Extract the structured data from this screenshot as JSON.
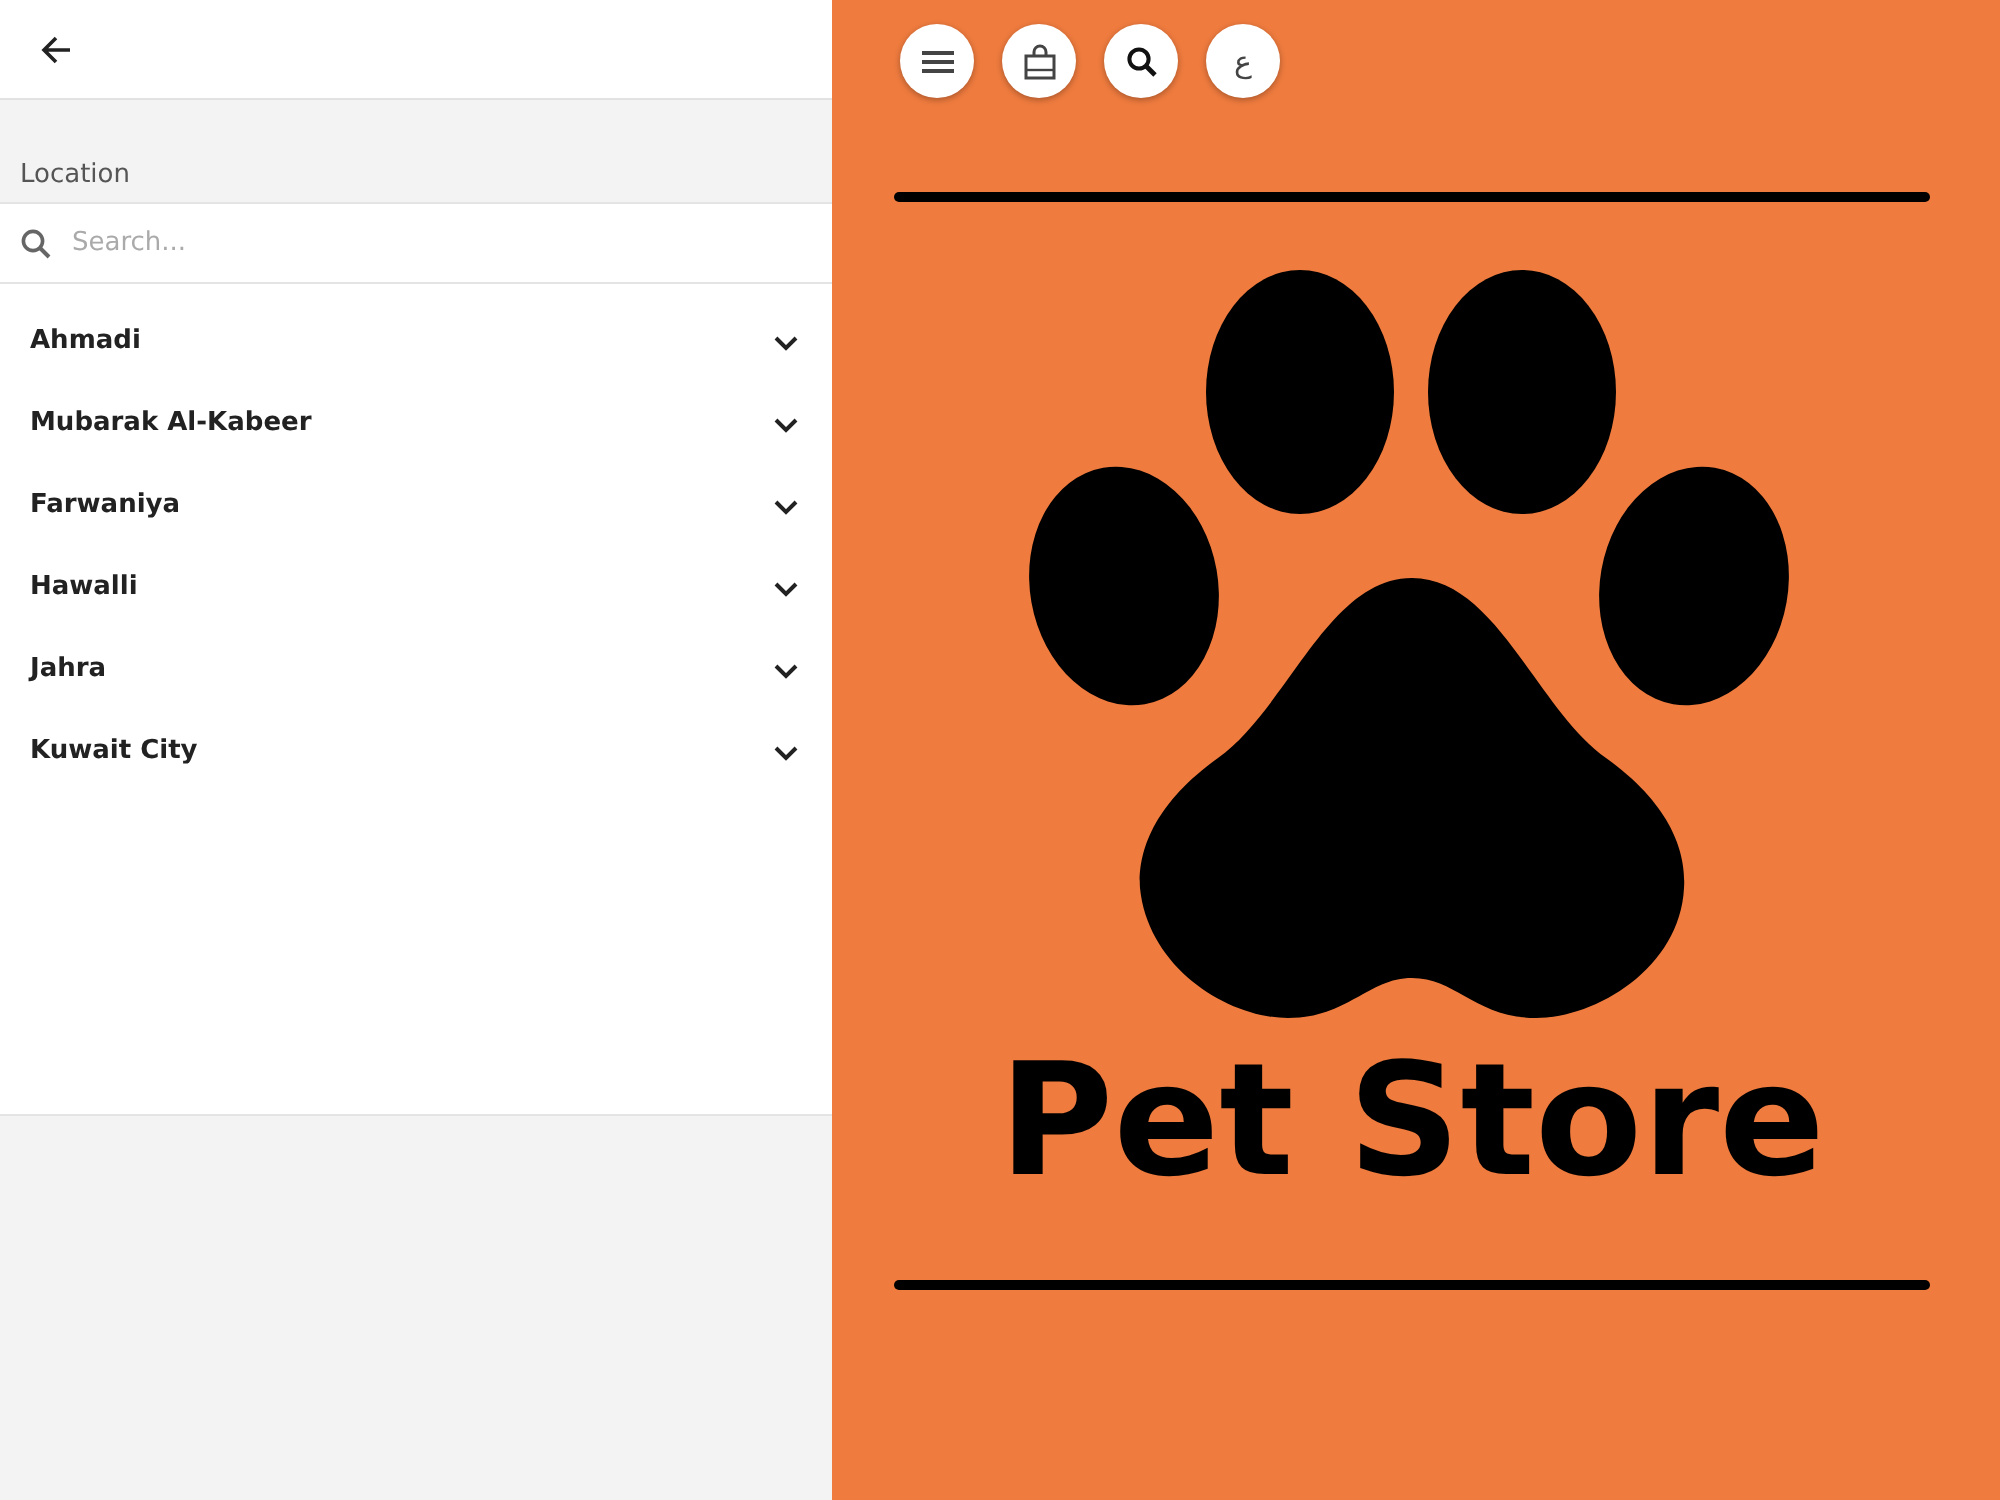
{
  "panel": {
    "section_label": "Location",
    "search": {
      "placeholder": "Search..."
    },
    "locations": [
      {
        "name": "Ahmadi",
        "expanded": false
      },
      {
        "name": "Mubarak Al-Kabeer",
        "expanded": false
      },
      {
        "name": "Farwaniya",
        "expanded": false
      },
      {
        "name": "Hawalli",
        "expanded": false
      },
      {
        "name": "Jahra",
        "expanded": false
      },
      {
        "name": "Kuwait City",
        "expanded": false
      }
    ]
  },
  "toolbar": [
    {
      "kind": "menu"
    },
    {
      "kind": "bag"
    },
    {
      "kind": "search"
    },
    {
      "kind": "language",
      "label": "ع"
    }
  ],
  "banner": {
    "title": "Pet Store"
  }
}
